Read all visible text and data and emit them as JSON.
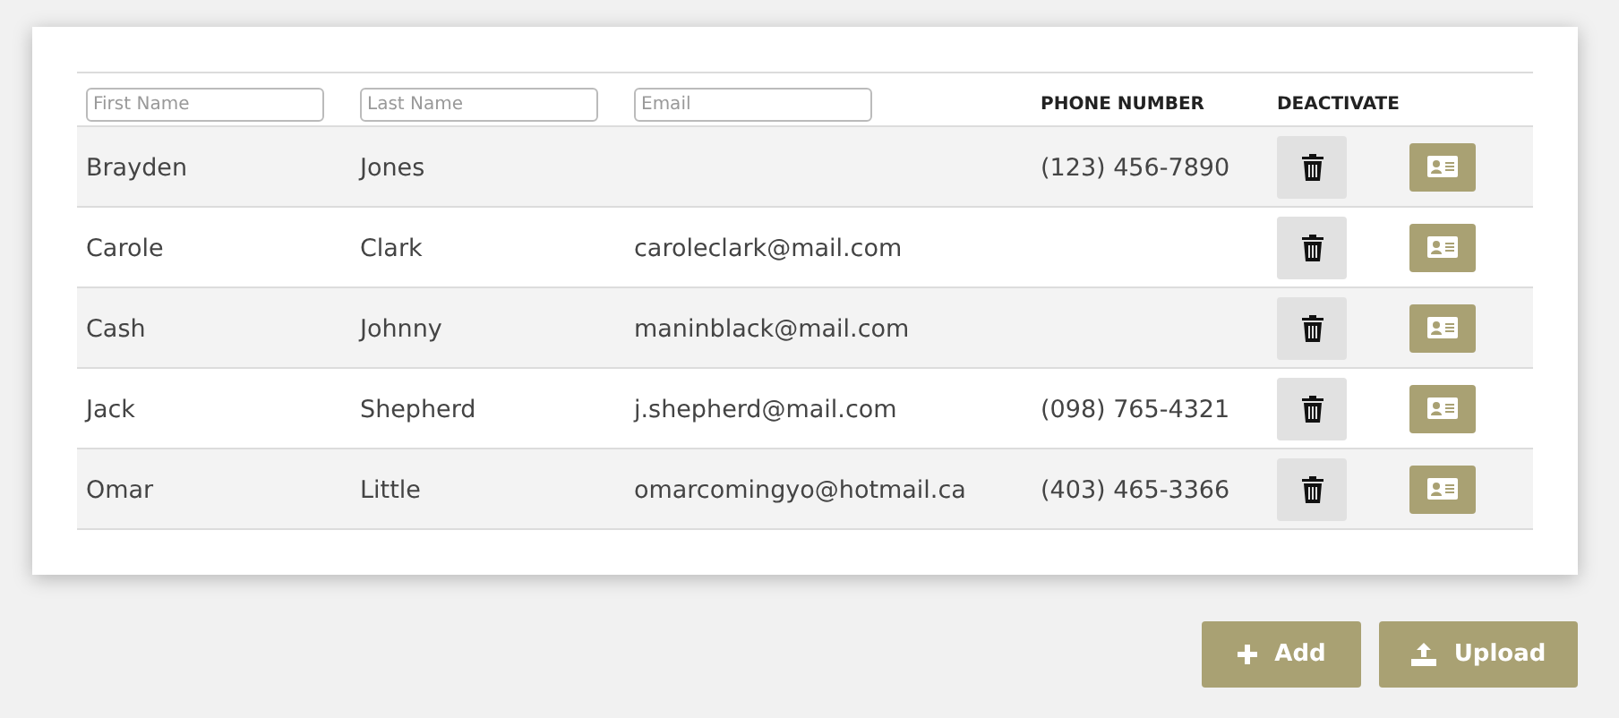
{
  "filters": [
    {
      "placeholder": "First Name"
    },
    {
      "placeholder": "Last Name"
    },
    {
      "placeholder": "Email"
    }
  ],
  "columns": [
    "PHONE NUMBER",
    "DEACTIVATE"
  ],
  "rows": [
    {
      "first_name": "Brayden",
      "last_name": "Jones",
      "phone": "(123) 456-7890"
    },
    {
      "first_name": "Carole",
      "last_name": "Clark",
      "email": "caroleclark@mail.com"
    },
    {
      "first_name": "Cash",
      "last_name": "Johnny",
      "email": "maninblack@mail.com"
    },
    {
      "first_name": "Jack",
      "last_name": "Shepherd",
      "email": "j.shepherd@mail.com",
      "phone": "(098) 765-4321"
    },
    {
      "first_name": "Omar",
      "last_name": "Little",
      "email": "omarcomingyo@hotmail.ca",
      "phone": "(403) 465-3366"
    }
  ],
  "buttons": [
    {
      "kind": "add",
      "label": "Add"
    },
    {
      "kind": "upload",
      "label": "Upload"
    }
  ]
}
